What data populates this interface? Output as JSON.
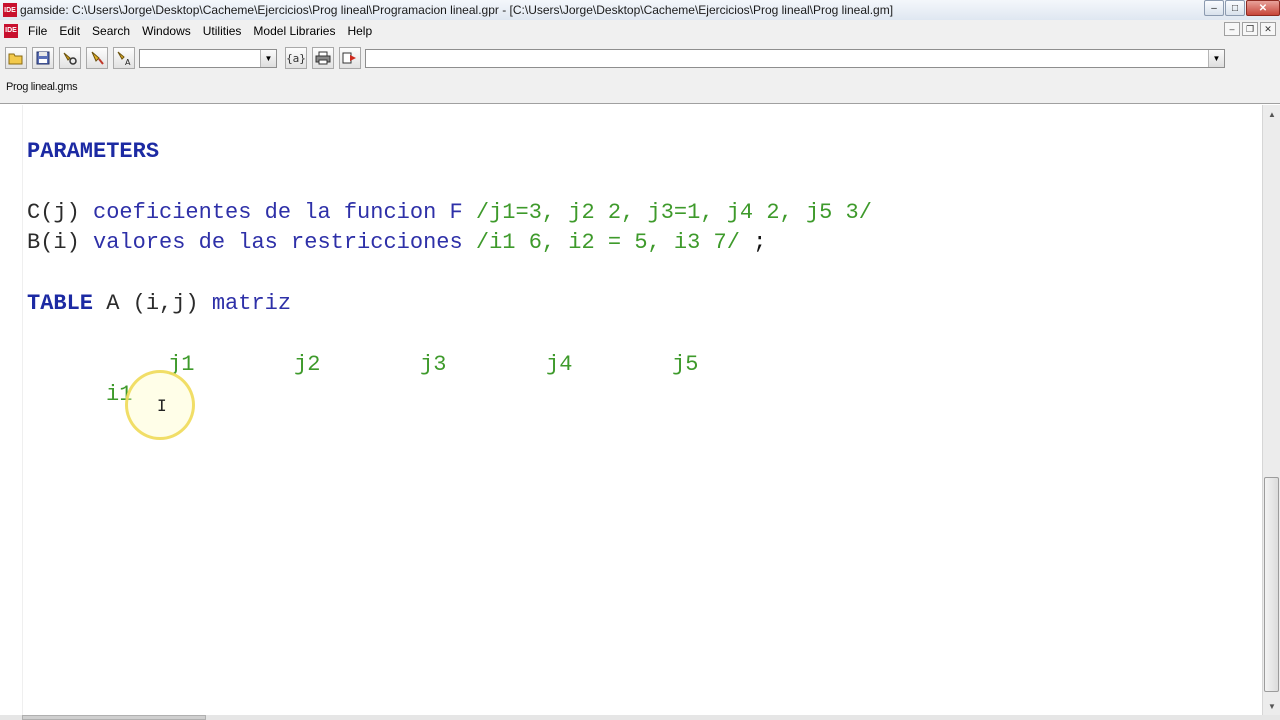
{
  "window": {
    "title": "gamside: C:\\Users\\Jorge\\Desktop\\Cacheme\\Ejercicios\\Prog lineal\\Programacion lineal.gpr - [C:\\Users\\Jorge\\Desktop\\Cacheme\\Ejercicios\\Prog lineal\\Prog lineal.gm]",
    "app_icon_text": "IDE",
    "controls": {
      "minimize": "–",
      "maximize": "□",
      "close": "✕"
    }
  },
  "menu": {
    "items": [
      "File",
      "Edit",
      "Search",
      "Windows",
      "Utilities",
      "Model Libraries",
      "Help"
    ],
    "mdi": {
      "minimize": "–",
      "restore": "❐",
      "close": "✕"
    }
  },
  "toolbar": {
    "combo_left_value": "",
    "macro_label": "{a}",
    "combo_right_value": ""
  },
  "tabs": {
    "active": "Prog lineal.gms"
  },
  "editor": {
    "parameters_kw": "PARAMETERS",
    "line_c": {
      "ident": "C(j)",
      "desc": "coeficientes de la funcion F",
      "data": "/j1=3, j2 2, j3=1, j4 2, j5 3/"
    },
    "line_b": {
      "ident": "B(i)",
      "desc": "valores de las restricciones",
      "data": "/i1 6, i2 = 5, i3 7/",
      "end": ";"
    },
    "table_line": {
      "kw": "TABLE",
      "ident": "A (i,j)",
      "desc": "matriz"
    },
    "columns": [
      "j1",
      "j2",
      "j3",
      "j4",
      "j5"
    ],
    "row_label": "i1"
  },
  "colors": {
    "keyword": "#1c2aa3",
    "description": "#2e30a8",
    "data": "#3e9a2b"
  }
}
